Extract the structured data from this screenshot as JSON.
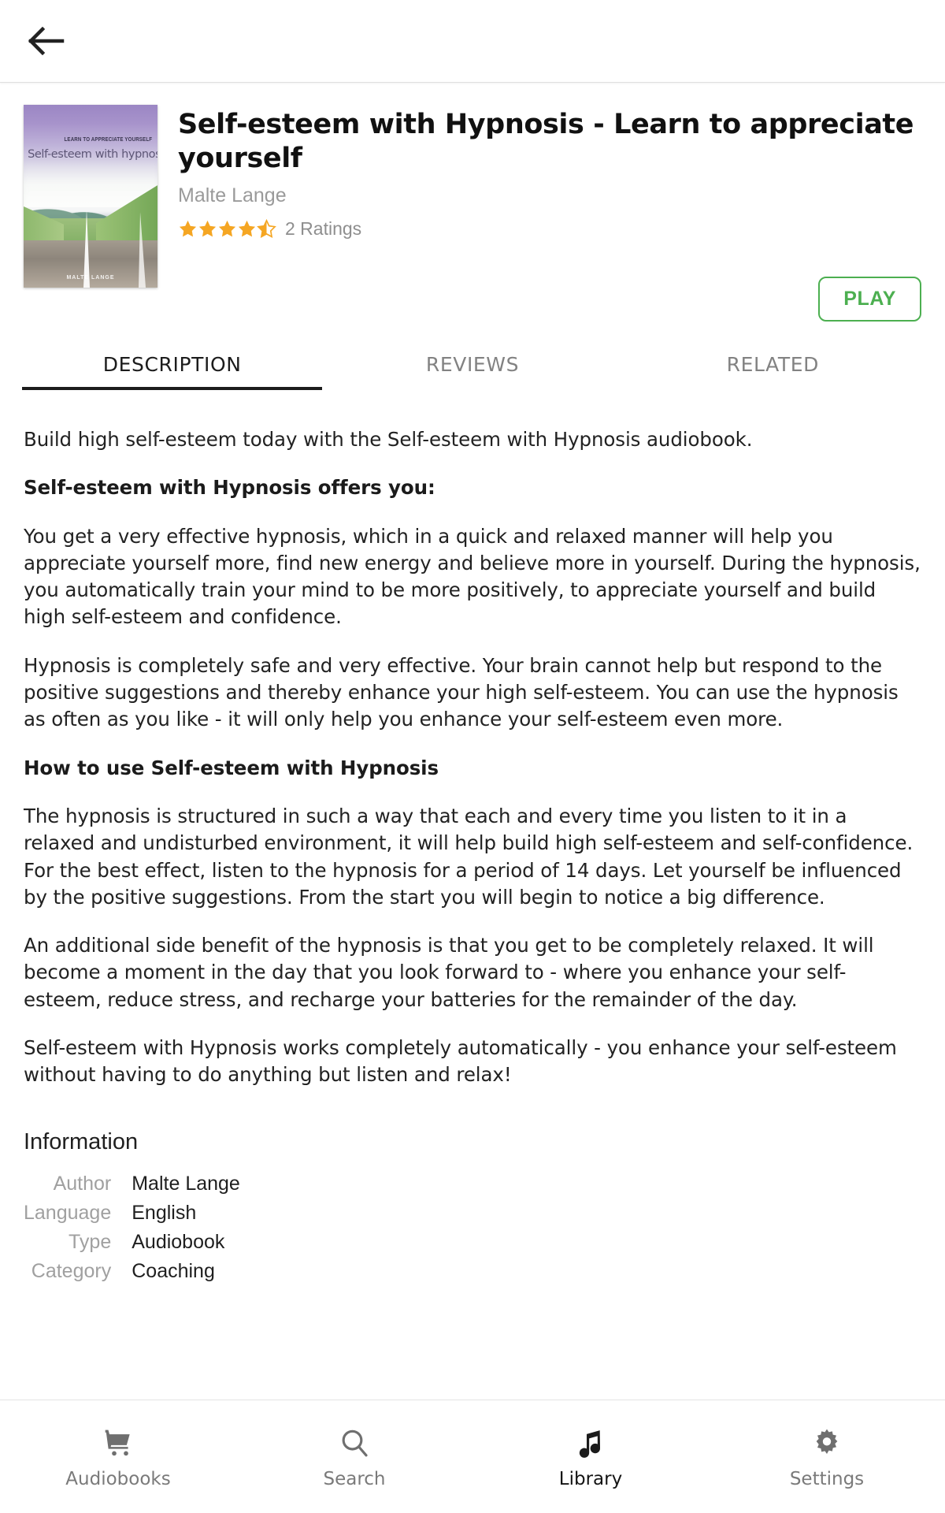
{
  "appbar": {
    "back_icon": "arrow-left-icon"
  },
  "book": {
    "title": "Self-esteem with Hypnosis - Learn to appreciate yourself",
    "author": "Malte Lange",
    "rating_stars": 4.5,
    "rating_count": "2 Ratings",
    "cover": {
      "kicker": "LEARN TO APPRECIATE YOURSELF",
      "title": "Self-esteem with hypnosis",
      "author": "MALTE LANGE"
    },
    "play_label": "PLAY",
    "play_color": "#4caf50"
  },
  "tabs": [
    {
      "label": "DESCRIPTION",
      "active": true
    },
    {
      "label": "REVIEWS",
      "active": false
    },
    {
      "label": "RELATED",
      "active": false
    }
  ],
  "description": {
    "paragraphs": [
      {
        "text": "Build high self-esteem today with the Self-esteem with Hypnosis audiobook.",
        "bold": false
      },
      {
        "text": "Self-esteem with Hypnosis offers you:",
        "bold": true
      },
      {
        "text": "You get a very effective hypnosis, which in a quick and relaxed manner will help you appreciate yourself more, find new energy and believe more in yourself. During the hypnosis, you automatically train your mind to be more positively, to appreciate yourself and build high self-esteem and confidence.",
        "bold": false
      },
      {
        "text": "Hypnosis is completely safe and very effective. Your brain cannot help but respond to the positive suggestions and thereby enhance your high self-esteem. You can use the hypnosis as often as you like - it will only help you enhance your self-esteem even more.",
        "bold": false
      },
      {
        "text": "How to use Self-esteem with Hypnosis",
        "bold": true
      },
      {
        "text": "The hypnosis is structured in such a way that each and every time you listen to it in a relaxed and undisturbed environment, it will help build high self-esteem and self-confidence. For the best effect, listen to the hypnosis for a period of 14 days. Let yourself be influenced by the positive suggestions. From the start you will begin to notice a big difference.",
        "bold": false
      },
      {
        "text": "An additional side benefit of the hypnosis is that you get to be completely relaxed. It will become a moment in the day that you look forward to - where you enhance your self-esteem, reduce stress, and recharge your batteries for the remainder of the day.",
        "bold": false
      },
      {
        "text": "Self-esteem with Hypnosis works completely automatically - you enhance your self-esteem without having to do anything but listen and relax!",
        "bold": false
      }
    ]
  },
  "information": {
    "heading": "Information",
    "rows": [
      {
        "key": "Author",
        "value": "Malte Lange"
      },
      {
        "key": "Language",
        "value": "English"
      },
      {
        "key": "Type",
        "value": "Audiobook"
      },
      {
        "key": "Category",
        "value": "Coaching"
      }
    ]
  },
  "bottom_nav": [
    {
      "label": "Audiobooks",
      "icon": "shopping-cart-icon",
      "active": false
    },
    {
      "label": "Search",
      "icon": "search-icon",
      "active": false
    },
    {
      "label": "Library",
      "icon": "music-note-icon",
      "active": true
    },
    {
      "label": "Settings",
      "icon": "gear-icon",
      "active": false
    }
  ]
}
